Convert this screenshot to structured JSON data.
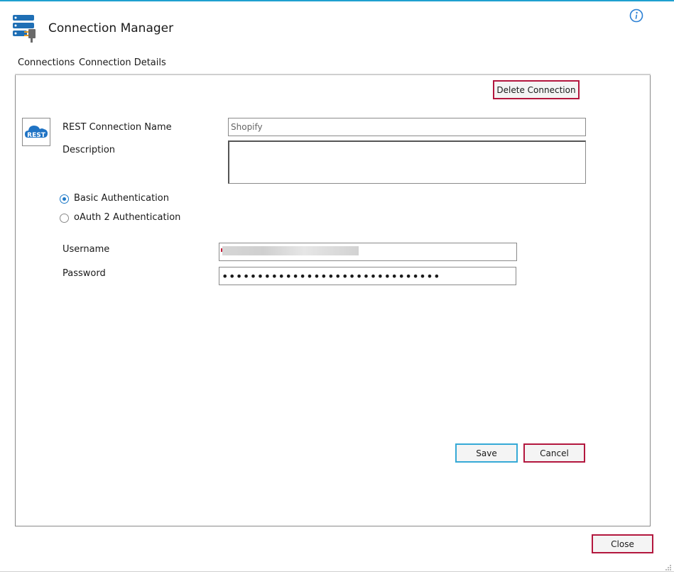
{
  "app": {
    "title": "Connection Manager",
    "icon": "server-plug-icon",
    "info_icon": "info-icon"
  },
  "tabs": [
    {
      "label": "Connections",
      "active": false
    },
    {
      "label": "Connection Details",
      "active": true
    }
  ],
  "form": {
    "delete_label": "Delete Connection",
    "logo_text": "REST",
    "name_label": "REST Connection Name",
    "name_value": "Shopify",
    "description_label": "Description",
    "description_value": "",
    "auth_options": [
      {
        "label": "Basic Authentication",
        "selected": true
      },
      {
        "label": "oAuth 2 Authentication",
        "selected": false
      }
    ],
    "username_label": "Username",
    "username_value": "",
    "password_label": "Password",
    "password_value": "•••••••••••••••••••••••••••••••",
    "save_label": "Save",
    "cancel_label": "Cancel"
  },
  "footer": {
    "close_label": "Close"
  },
  "colors": {
    "accent": "#1fa0d0",
    "danger_border": "#b3173e",
    "primary_border": "#36a9d6"
  }
}
